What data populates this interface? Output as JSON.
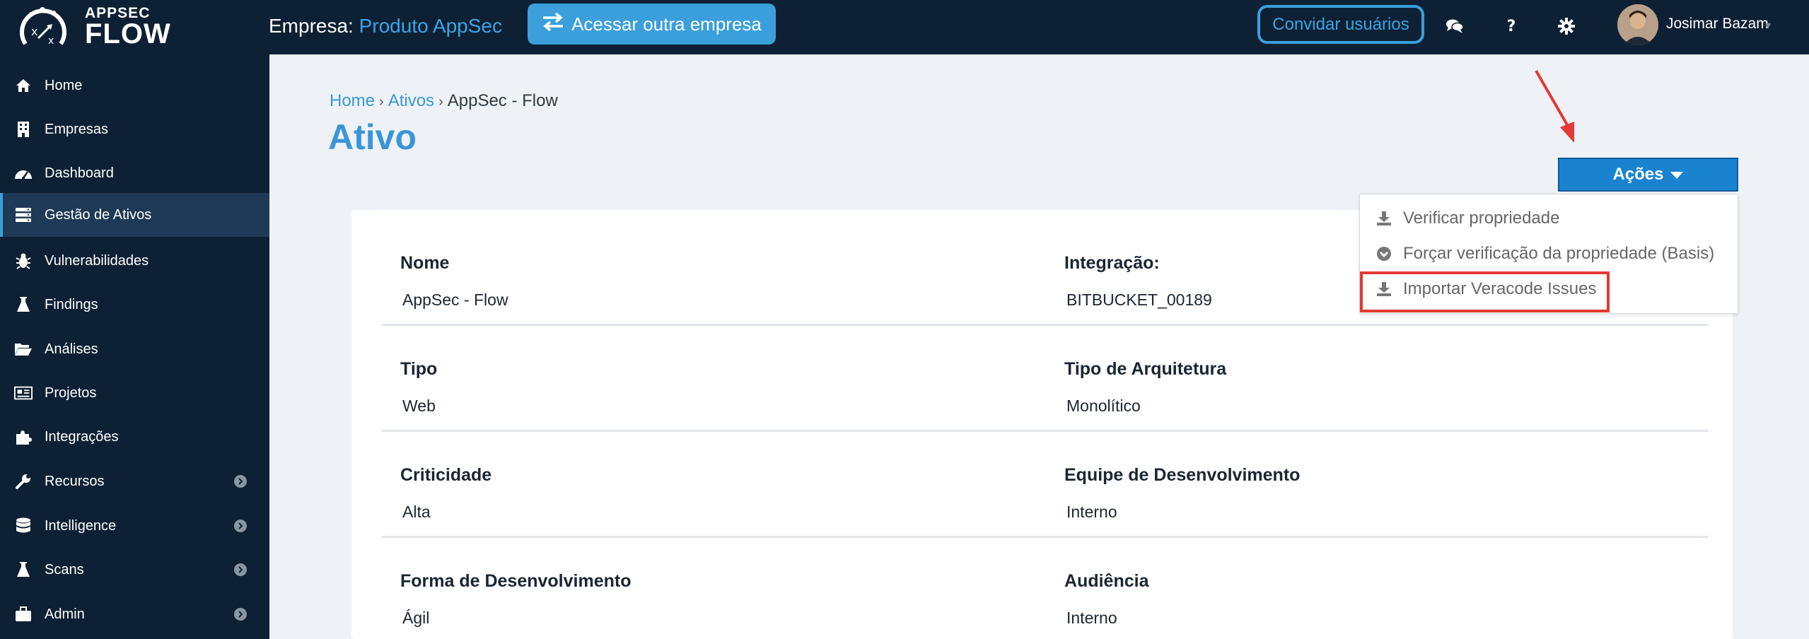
{
  "brand": {
    "line1": "APPSEC",
    "line2": "FLOW"
  },
  "header": {
    "company_label": "Empresa:",
    "company_name": "Produto AppSec",
    "switch_button": "Acessar outra empresa",
    "invite_button": "Convidar usuários",
    "user_name": "Josimar Bazam",
    "icons": [
      "comments-icon",
      "question-icon",
      "gear-icon"
    ]
  },
  "sidebar": {
    "items": [
      {
        "label": "Home",
        "icon": "home-icon"
      },
      {
        "label": "Empresas",
        "icon": "building-icon"
      },
      {
        "label": "Dashboard",
        "icon": "dashboard-icon"
      },
      {
        "label": "Gestão de Ativos",
        "icon": "server-icon",
        "active": true
      },
      {
        "label": "Vulnerabilidades",
        "icon": "bug-icon"
      },
      {
        "label": "Findings",
        "icon": "flask-icon"
      },
      {
        "label": "Análises",
        "icon": "folder-open-icon"
      },
      {
        "label": "Projetos",
        "icon": "newspaper-icon"
      },
      {
        "label": "Integrações",
        "icon": "puzzle-icon"
      },
      {
        "label": "Recursos",
        "icon": "wrench-icon",
        "expandable": true
      },
      {
        "label": "Intelligence",
        "icon": "database-icon",
        "expandable": true
      },
      {
        "label": "Scans",
        "icon": "flask-icon",
        "expandable": true
      },
      {
        "label": "Admin",
        "icon": "briefcase-icon",
        "expandable": true
      }
    ]
  },
  "breadcrumb": {
    "home": "Home",
    "ativos": "Ativos",
    "current": "AppSec - Flow"
  },
  "page_title": "Ativo",
  "actions": {
    "button": "Ações",
    "menu": [
      {
        "label": "Verificar propriedade",
        "icon": "download-icon"
      },
      {
        "label": "Forçar verificação da propriedade (Basis)",
        "icon": "chevron-circle-down-icon"
      },
      {
        "label": "Importar Veracode Issues",
        "icon": "download-icon",
        "highlighted": true
      }
    ]
  },
  "fields": {
    "nome": {
      "label": "Nome",
      "value": "AppSec - Flow"
    },
    "integracao": {
      "label": "Integração:",
      "value": "BITBUCKET_00189"
    },
    "tipo": {
      "label": "Tipo",
      "value": "Web"
    },
    "arquitetura": {
      "label": "Tipo de Arquitetura",
      "value": "Monolítico"
    },
    "criticidade": {
      "label": "Criticidade",
      "value": "Alta"
    },
    "equipe": {
      "label": "Equipe de Desenvolvimento",
      "value": "Interno"
    },
    "forma": {
      "label": "Forma de Desenvolvimento",
      "value": "Ágil"
    },
    "audiencia": {
      "label": "Audiência",
      "value": "Interno"
    }
  },
  "colors": {
    "sidebar": "#0e2134",
    "accent": "#3a9fdb",
    "primary_button": "#1a83d0",
    "highlight": "#e53935"
  }
}
